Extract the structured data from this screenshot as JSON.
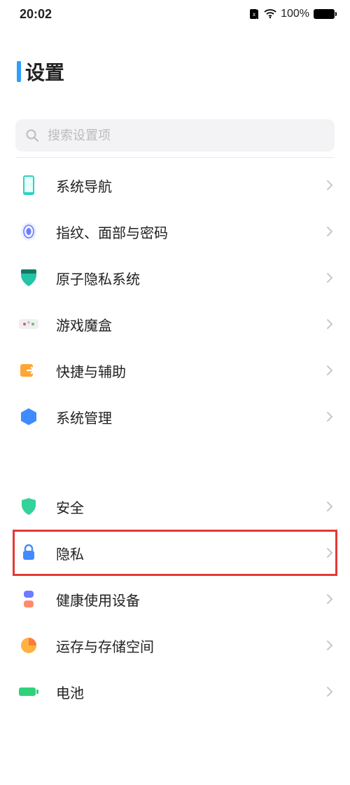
{
  "status": {
    "time": "20:02",
    "battery_pct": "100%"
  },
  "page": {
    "title": "设置"
  },
  "search": {
    "placeholder": "搜索设置项"
  },
  "groups": [
    {
      "items": [
        {
          "key": "nav",
          "label": "系统导航"
        },
        {
          "key": "biometric",
          "label": "指纹、面部与密码"
        },
        {
          "key": "atom",
          "label": "原子隐私系统"
        },
        {
          "key": "gamebox",
          "label": "游戏魔盒"
        },
        {
          "key": "shortcut",
          "label": "快捷与辅助"
        },
        {
          "key": "sysmgr",
          "label": "系统管理"
        }
      ]
    },
    {
      "items": [
        {
          "key": "security",
          "label": "安全"
        },
        {
          "key": "privacy",
          "label": "隐私",
          "highlight": true
        },
        {
          "key": "health",
          "label": "健康使用设备"
        },
        {
          "key": "storage",
          "label": "运存与存储空间"
        },
        {
          "key": "battery",
          "label": "电池"
        }
      ]
    }
  ]
}
